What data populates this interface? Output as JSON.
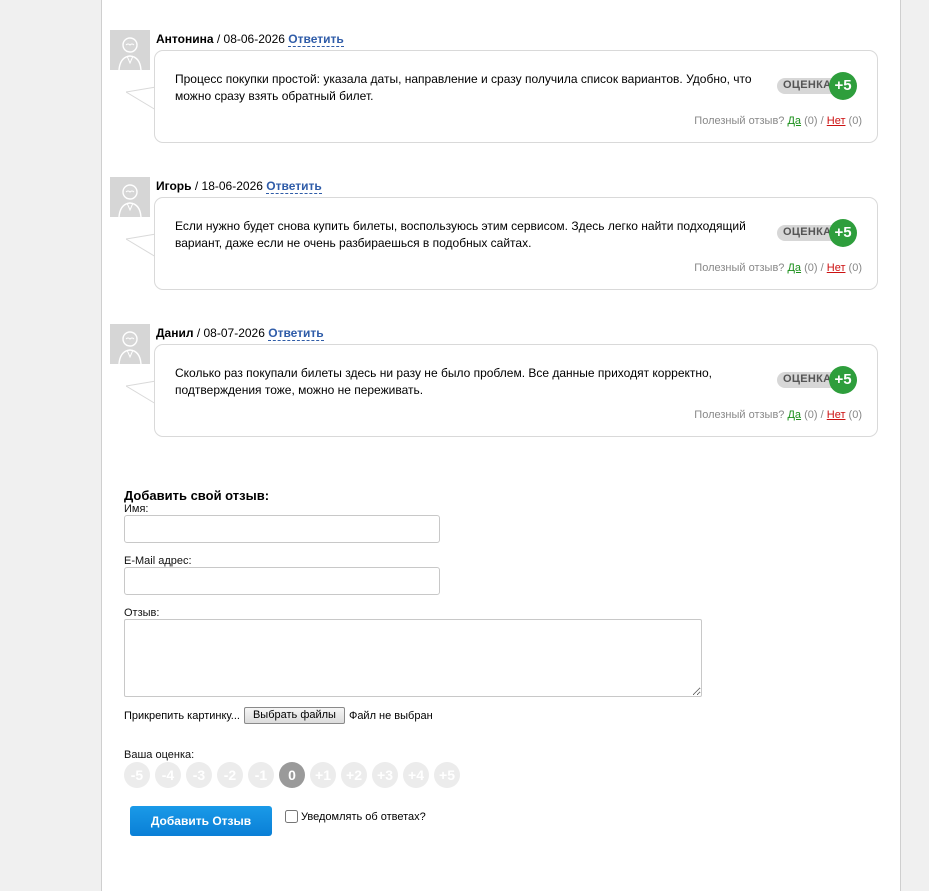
{
  "reviews": [
    {
      "author": "Антонина",
      "date": "08-06-2026",
      "reply_label": "Ответить",
      "text": "Процесс покупки простой: указала даты, направление и сразу получила список вариантов. Удобно, что можно сразу взять обратный билет.",
      "rating_label": "ОЦЕНКА",
      "rating_value": "+5",
      "helpful_label": "Полезный отзыв?",
      "yes_label": "Да",
      "yes_count": "(0)",
      "no_label": "Нет",
      "no_count": "(0)"
    },
    {
      "author": "Игорь",
      "date": "18-06-2026",
      "reply_label": "Ответить",
      "text": "Если нужно будет снова купить билеты, воспользуюсь этим сервисом. Здесь легко найти подходящий вариант, даже если не очень разбираешься в подобных сайтах.",
      "rating_label": "ОЦЕНКА",
      "rating_value": "+5",
      "helpful_label": "Полезный отзыв?",
      "yes_label": "Да",
      "yes_count": "(0)",
      "no_label": "Нет",
      "no_count": "(0)"
    },
    {
      "author": "Данил",
      "date": "08-07-2026",
      "reply_label": "Ответить",
      "text": "Сколько раз покупали билеты здесь ни разу не было проблем. Все данные приходят корректно, подтверждения тоже, можно не переживать.",
      "rating_label": "ОЦЕНКА",
      "rating_value": "+5",
      "helpful_label": "Полезный отзыв?",
      "yes_label": "Да",
      "yes_count": "(0)",
      "no_label": "Нет",
      "no_count": "(0)"
    }
  ],
  "form": {
    "title": "Добавить свой отзыв:",
    "name_label": "Имя:",
    "name_value": "",
    "email_label": "E-Mail адрес:",
    "email_value": "",
    "review_label": "Отзыв:",
    "review_value": "",
    "attach_label": "Прикрепить картинку...",
    "file_button": "Выбрать файлы",
    "no_file": "Файл не выбран",
    "rating_label": "Ваша оценка:",
    "scores": [
      "-5",
      "-4",
      "-3",
      "-2",
      "-1",
      "0",
      "+1",
      "+2",
      "+3",
      "+4",
      "+5"
    ],
    "selected_score": "0",
    "submit_label": "Добавить Отзыв",
    "notify_label": "Уведомлять об ответах?",
    "notify_checked": false
  },
  "colors": {
    "rating_badge": "#2e9e3c",
    "yes_link": "#1a8f1a",
    "no_link": "#cc1111",
    "submit_button": "#0a7fd6",
    "reply_link": "#2f5ca8"
  }
}
